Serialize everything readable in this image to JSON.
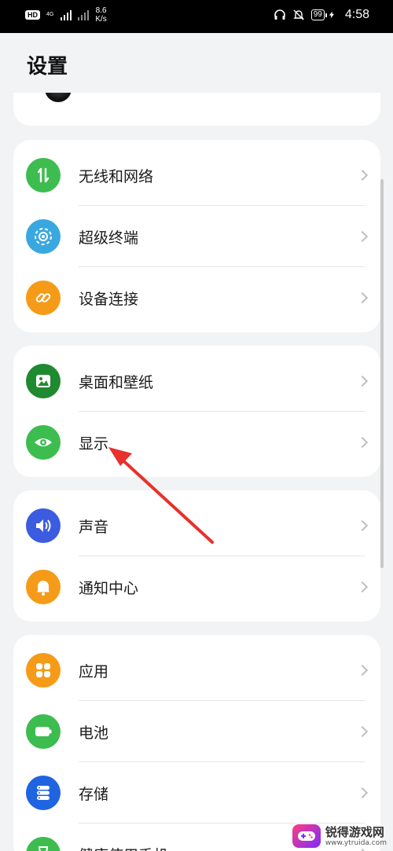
{
  "status_bar": {
    "hd_label": "HD",
    "network_label": "4G",
    "speed_value": "8.6",
    "speed_unit": "K/s",
    "battery_level": "99",
    "time": "4:58"
  },
  "page": {
    "title": "设置"
  },
  "groups": [
    {
      "items": [
        {
          "label": "无线和网络",
          "icon": "wireless-network-icon",
          "color": "#3dbd4f"
        },
        {
          "label": "超级终端",
          "icon": "super-device-icon",
          "color": "#3aa8e0"
        },
        {
          "label": "设备连接",
          "icon": "device-connection-icon",
          "color": "#f59b18"
        }
      ]
    },
    {
      "items": [
        {
          "label": "桌面和壁纸",
          "icon": "wallpaper-icon",
          "color": "#1f8a2f"
        },
        {
          "label": "显示",
          "icon": "eye-icon",
          "color": "#3dbd4f"
        }
      ]
    },
    {
      "items": [
        {
          "label": "声音",
          "icon": "speaker-icon",
          "color": "#3b5ce0"
        },
        {
          "label": "通知中心",
          "icon": "bell-icon",
          "color": "#f59b18"
        }
      ]
    },
    {
      "items": [
        {
          "label": "应用",
          "icon": "apps-icon",
          "color": "#f59b18"
        },
        {
          "label": "电池",
          "icon": "battery-icon",
          "color": "#3dbd4f"
        },
        {
          "label": "存储",
          "icon": "storage-icon",
          "color": "#1f64e0"
        },
        {
          "label": "健康使用手机",
          "icon": "hourglass-icon",
          "color": "#3dbd4f"
        }
      ]
    }
  ],
  "watermark": {
    "title": "锐得游戏网",
    "url": "www.ytruida.com"
  },
  "annotation": {
    "arrow_color": "#e8302c"
  }
}
